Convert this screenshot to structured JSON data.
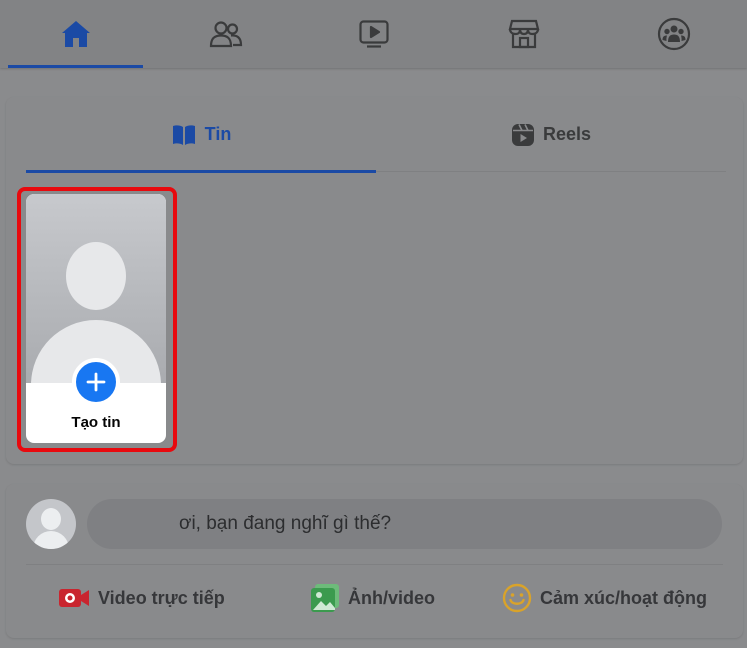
{
  "nav": {
    "items": [
      {
        "icon": "home-icon",
        "active": true
      },
      {
        "icon": "friends-icon",
        "active": false
      },
      {
        "icon": "watch-icon",
        "active": false
      },
      {
        "icon": "marketplace-icon",
        "active": false
      },
      {
        "icon": "groups-icon",
        "active": false
      }
    ]
  },
  "stories": {
    "tabs": [
      {
        "label": "Tin",
        "icon": "book-icon",
        "active": true
      },
      {
        "label": "Reels",
        "icon": "reels-icon",
        "active": false
      }
    ],
    "create_label": "Tạo tin"
  },
  "composer": {
    "placeholder": "ơi, bạn đang nghĩ gì thế?",
    "actions": [
      {
        "label": "Video trực tiếp",
        "icon": "live-video-icon",
        "color": "#c9252f"
      },
      {
        "label": "Ảnh/video",
        "icon": "photo-icon",
        "color": "#3b9a4e"
      },
      {
        "label": "Cảm xúc/hoạt động",
        "icon": "feeling-icon",
        "color": "#d9a32a"
      }
    ]
  },
  "colors": {
    "accent": "#1b4aa5",
    "highlight_border": "#e8090e",
    "create_plus": "#1877f2"
  }
}
